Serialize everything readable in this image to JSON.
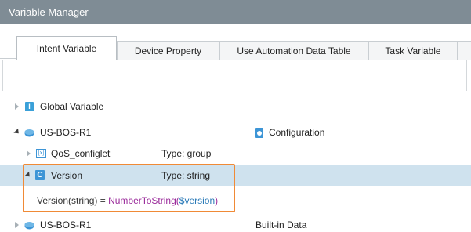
{
  "window": {
    "title": "Variable Manager"
  },
  "tabs": [
    {
      "label": "Intent Variable",
      "active": true
    },
    {
      "label": "Device Property",
      "active": false
    },
    {
      "label": "Use Automation Data Table",
      "active": false
    },
    {
      "label": "Task Variable",
      "active": false
    }
  ],
  "tree": {
    "global_variable": {
      "label": "Global Variable",
      "icon": "info-icon"
    },
    "device1": {
      "label": "US-BOS-R1",
      "category": "Configuration",
      "icon": "device-icon",
      "category_icon": "config-file-icon"
    },
    "qos": {
      "label": "QoS_configlet",
      "type": "Type: group",
      "icon": "variable-x-icon"
    },
    "version": {
      "label": "Version",
      "type": "Type: string",
      "icon": "c-letter-icon"
    },
    "version_formula": {
      "prefix": "Version",
      "param": "(string)",
      "equals": " = ",
      "function": "NumberToString",
      "open_paren": "(",
      "argument": "$version",
      "close_paren": ")"
    },
    "device2": {
      "label": "US-BOS-R1",
      "category": "Built-in Data",
      "icon": "device-icon"
    }
  },
  "colors": {
    "titlebar": "#7f8c95",
    "selected_row": "#cfe2ee",
    "highlight_border": "#f08a36",
    "function_text": "#9a2a9a",
    "variable_text": "#2a7ab8",
    "icon_blue": "#3d95d6"
  }
}
